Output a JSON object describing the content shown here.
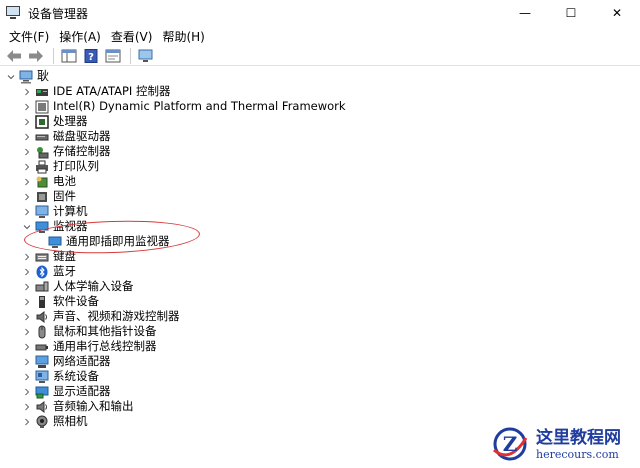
{
  "window": {
    "title": "设备管理器",
    "minimize": "—",
    "maximize": "☐",
    "close": "✕"
  },
  "menu": [
    "文件(F)",
    "操作(A)",
    "查看(V)",
    "帮助(H)"
  ],
  "tree": {
    "root": "耿",
    "items": [
      {
        "label": "IDE ATA/ATAPI 控制器",
        "icon": "ide-controller-icon",
        "expanded": false
      },
      {
        "label": "Intel(R) Dynamic Platform and Thermal Framework",
        "icon": "intel-framework-icon",
        "expanded": false
      },
      {
        "label": "处理器",
        "icon": "processor-icon",
        "expanded": false
      },
      {
        "label": "磁盘驱动器",
        "icon": "disk-drive-icon",
        "expanded": false
      },
      {
        "label": "存储控制器",
        "icon": "storage-controller-icon",
        "expanded": false
      },
      {
        "label": "打印队列",
        "icon": "printer-icon",
        "expanded": false
      },
      {
        "label": "电池",
        "icon": "battery-icon",
        "expanded": false
      },
      {
        "label": "固件",
        "icon": "firmware-icon",
        "expanded": false
      },
      {
        "label": "计算机",
        "icon": "computer-icon",
        "expanded": false
      },
      {
        "label": "监视器",
        "icon": "monitor-icon",
        "expanded": true,
        "children": [
          "通用即插即用监视器"
        ]
      },
      {
        "label": "键盘",
        "icon": "keyboard-icon",
        "expanded": false
      },
      {
        "label": "蓝牙",
        "icon": "bluetooth-icon",
        "expanded": false
      },
      {
        "label": "人体学输入设备",
        "icon": "hid-icon",
        "expanded": false
      },
      {
        "label": "软件设备",
        "icon": "software-device-icon",
        "expanded": false
      },
      {
        "label": "声音、视频和游戏控制器",
        "icon": "sound-icon",
        "expanded": false
      },
      {
        "label": "鼠标和其他指针设备",
        "icon": "mouse-icon",
        "expanded": false
      },
      {
        "label": "通用串行总线控制器",
        "icon": "usb-icon",
        "expanded": false
      },
      {
        "label": "网络适配器",
        "icon": "network-adapter-icon",
        "expanded": false
      },
      {
        "label": "系统设备",
        "icon": "system-device-icon",
        "expanded": false
      },
      {
        "label": "显示适配器",
        "icon": "display-adapter-icon",
        "expanded": false
      },
      {
        "label": "音频输入和输出",
        "icon": "audio-io-icon",
        "expanded": false
      },
      {
        "label": "照相机",
        "icon": "camera-icon",
        "expanded": false
      }
    ]
  },
  "watermark": {
    "cn": "这里教程网",
    "en": "herecours.com"
  },
  "colors": {
    "annotation": "#d63a3a",
    "watermark": "#1f3c9e"
  }
}
